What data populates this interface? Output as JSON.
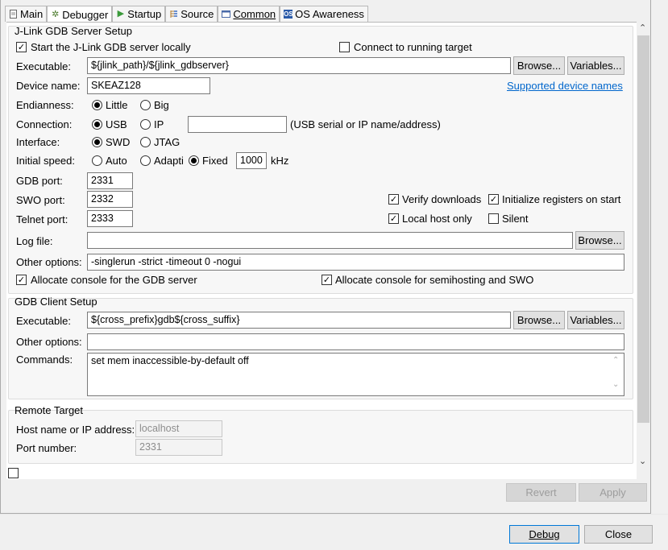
{
  "tabs": [
    {
      "label": "Main",
      "icon": "document-icon"
    },
    {
      "label": "Debugger",
      "icon": "bug-icon"
    },
    {
      "label": "Startup",
      "icon": "play-icon"
    },
    {
      "label": "Source",
      "icon": "source-icon"
    },
    {
      "label": "Common",
      "icon": "common-icon"
    },
    {
      "label": "OS Awareness",
      "icon": "os-icon"
    }
  ],
  "server": {
    "title": "J-Link GDB Server Setup",
    "start_locally": "Start the J-Link GDB server locally",
    "connect_running": "Connect to running target",
    "executable_label": "Executable:",
    "executable_value": "${jlink_path}/${jlink_gdbserver}",
    "browse": "Browse...",
    "variables": "Variables...",
    "device_label": "Device name:",
    "device_value": "SKEAZ128",
    "supported_link": "Supported device names",
    "endianness_label": "Endianness:",
    "little": "Little",
    "big": "Big",
    "connection_label": "Connection:",
    "usb": "USB",
    "ip": "IP",
    "connection_hint": "(USB serial or IP name/address)",
    "interface_label": "Interface:",
    "swd": "SWD",
    "jtag": "JTAG",
    "speed_label": "Initial speed:",
    "auto": "Auto",
    "adaptive": "Adapti",
    "fixed": "Fixed",
    "speed_value": "1000",
    "speed_unit": "kHz",
    "gdb_port_label": "GDB port:",
    "gdb_port": "2331",
    "swo_port_label": "SWO port:",
    "swo_port": "2332",
    "telnet_port_label": "Telnet port:",
    "telnet_port": "2333",
    "verify": "Verify downloads",
    "init_regs": "Initialize registers on start",
    "local_host": "Local host only",
    "silent": "Silent",
    "log_label": "Log file:",
    "log_value": "",
    "other_label": "Other options:",
    "other_value": "-singlerun -strict -timeout 0 -nogui",
    "alloc_console": "Allocate console for the GDB server",
    "alloc_semihosting": "Allocate console for semihosting and SWO"
  },
  "client": {
    "title": "GDB Client Setup",
    "executable_label": "Executable:",
    "executable_value": "${cross_prefix}gdb${cross_suffix}",
    "browse": "Browse...",
    "variables": "Variables...",
    "other_label": "Other options:",
    "other_value": "",
    "commands_label": "Commands:",
    "commands_value": "set mem inaccessible-by-default off"
  },
  "remote": {
    "title": "Remote Target",
    "host_label": "Host name or IP address:",
    "host_value": "localhost",
    "port_label": "Port number:",
    "port_value": "2331"
  },
  "footer": {
    "revert": "Revert",
    "apply": "Apply",
    "debug": "Debug",
    "close": "Close"
  }
}
